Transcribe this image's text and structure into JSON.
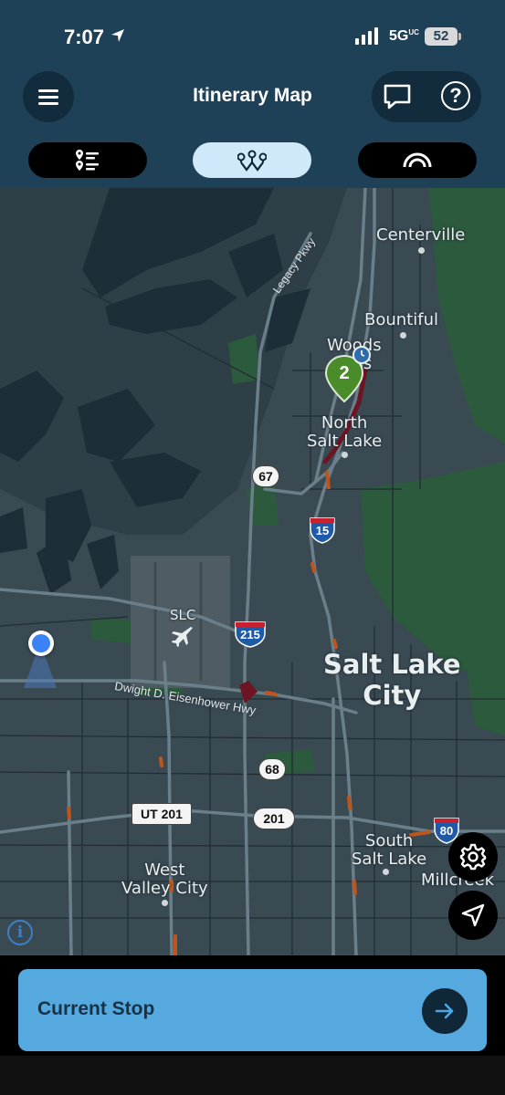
{
  "status_bar": {
    "time": "7:07",
    "network": "5G",
    "network_suffix": "UC",
    "battery": "52"
  },
  "header": {
    "title": "Itinerary Map",
    "menu_icon": "hamburger-menu-icon",
    "chat_icon": "chat-bubble-icon",
    "help_icon": "question-icon",
    "help_glyph": "?"
  },
  "tabs": [
    {
      "name": "stop-list-tab",
      "icon": "stop-list-icon",
      "active": false
    },
    {
      "name": "route-map-tab",
      "icon": "route-icon",
      "active": true
    },
    {
      "name": "speed-tab",
      "icon": "gauge-icon",
      "active": false
    }
  ],
  "map": {
    "places": {
      "centerville": "Centerville",
      "bountiful": "Bountiful",
      "woods_cross_1": "Woods",
      "woods_cross_2": "ss",
      "north_salt_lake_1": "North",
      "north_salt_lake_2": "Salt Lake",
      "slc_airport": "SLC",
      "salt_lake_city_1": "Salt Lake",
      "salt_lake_city_2": "City",
      "south_salt_lake_1": "South",
      "south_salt_lake_2": "Salt Lake",
      "west_valley_1": "West",
      "west_valley_2": "Valley City",
      "millcreek": "Millcreek"
    },
    "roads": {
      "legacy_pkwy": "Legacy Pkwy",
      "eisenhower_hwy": "Dwight D. Eisenhower Hwy"
    },
    "shields": {
      "i15": "15",
      "i215": "215",
      "i80": "80",
      "sr67": "67",
      "sr68": "68",
      "sr201": "201",
      "ut201": "UT 201"
    },
    "stop_marker": "2",
    "info_glyph": "i",
    "colors": {
      "marker_green": "#4a8c2a",
      "user_location": "#3b82f6",
      "congestion": "#c0551c",
      "interstate_blue": "#1f5aa8",
      "interstate_red": "#c8202f"
    }
  },
  "map_controls": {
    "settings_icon": "gear-icon",
    "recenter_icon": "navigation-arrow-icon",
    "info_icon": "info-icon"
  },
  "bottom": {
    "current_stop_label": "Current Stop",
    "go_icon": "arrow-right-icon"
  }
}
